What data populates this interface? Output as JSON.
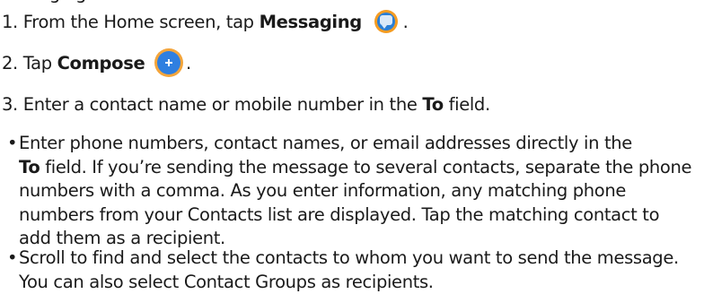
{
  "cut_line": "nessaging",
  "steps": [
    {
      "number": "1.",
      "before": "From the Home screen, tap ",
      "bold": "Messaging",
      "after": " ."
    },
    {
      "number": "2.",
      "before": "Tap ",
      "bold": "Compose",
      "after": " ."
    },
    {
      "number": "3.",
      "before": "Enter a contact name or mobile number in the ",
      "bold": "To",
      "after": " field."
    }
  ],
  "bullets": [
    {
      "intro": "Enter phone numbers, contact names, or email addresses directly in the",
      "bold": "To",
      "rest": " field. If you’re sending the message to several contacts, separate the phone numbers with a comma. As you enter information, any matching phone numbers from your Contacts list are displayed. Tap the matching contact to add them as a recipient."
    },
    {
      "text": "Scroll to find and select the contacts to whom you want to send the message. You can also select Contact Groups as recipients."
    }
  ],
  "icons": {
    "messaging": "messaging-icon",
    "compose": "compose-icon"
  },
  "colors": {
    "messaging_bg": "#f59c22",
    "messaging_inner": "#2b7fd6",
    "compose_bg": "#2f7fe0",
    "compose_ring": "#f4a53b"
  }
}
